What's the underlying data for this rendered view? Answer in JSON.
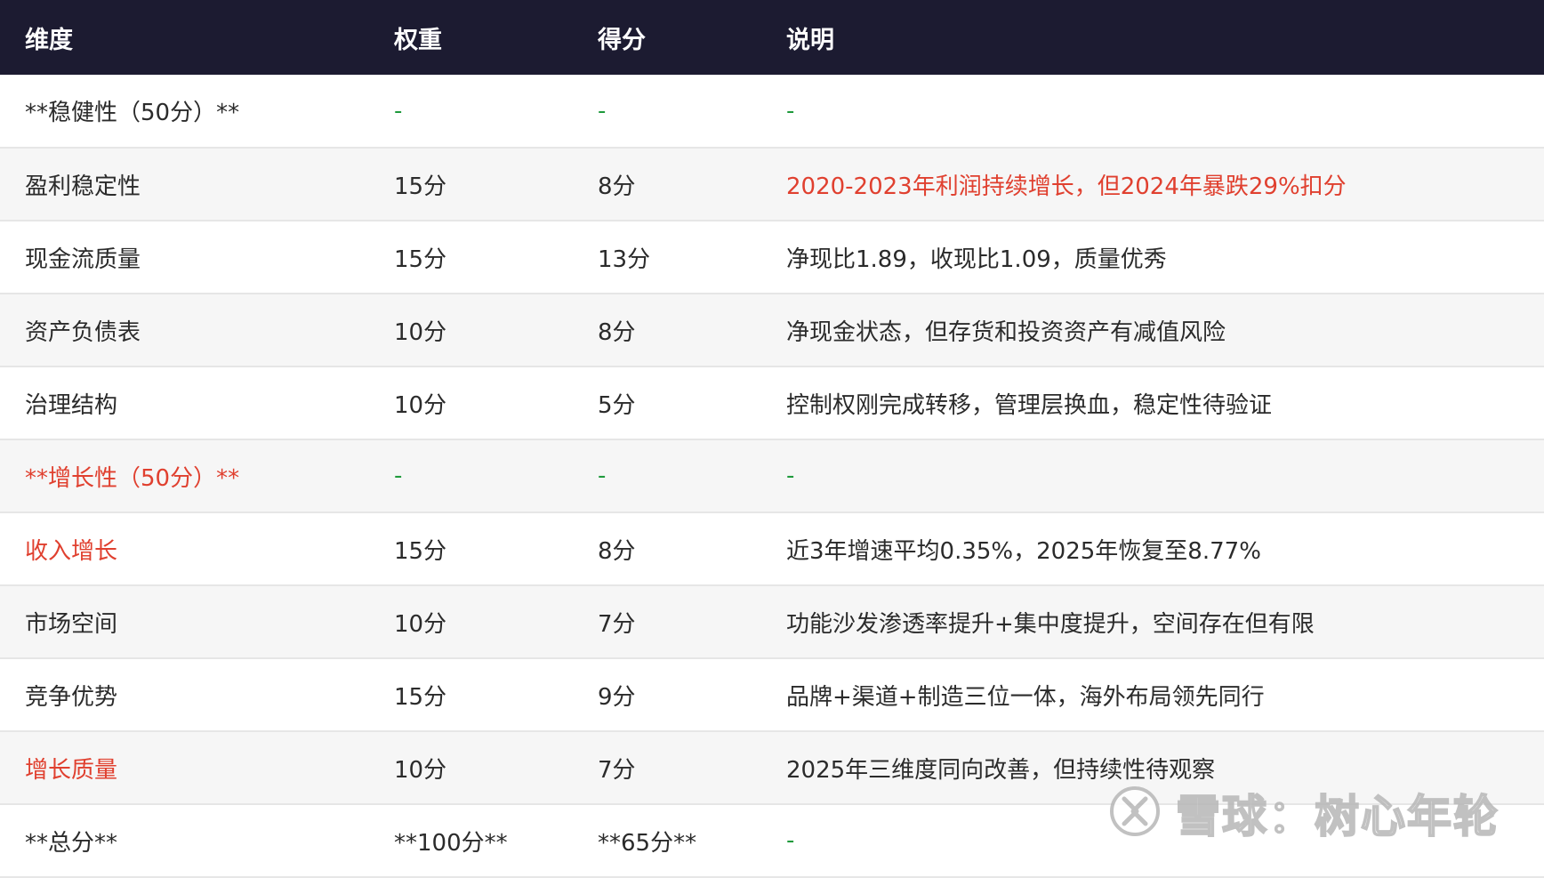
{
  "table": {
    "headers": [
      "维度",
      "权重",
      "得分",
      "说明"
    ],
    "rows": [
      {
        "dimension": "**稳健性（50分）**",
        "weight": "-",
        "score": "-",
        "note": "-"
      },
      {
        "dimension": "盈利稳定性",
        "weight": "15分",
        "score": "8分",
        "note": "2020-2023年利润持续增长，但2024年暴跌29%扣分"
      },
      {
        "dimension": "现金流质量",
        "weight": "15分",
        "score": "13分",
        "note": "净现比1.89，收现比1.09，质量优秀"
      },
      {
        "dimension": "资产负债表",
        "weight": "10分",
        "score": "8分",
        "note": "净现金状态，但存货和投资资产有减值风险"
      },
      {
        "dimension": "治理结构",
        "weight": "10分",
        "score": "5分",
        "note": "控制权刚完成转移，管理层换血，稳定性待验证"
      },
      {
        "dimension": "**增长性（50分）**",
        "weight": "-",
        "score": "-",
        "note": "-"
      },
      {
        "dimension": "收入增长",
        "weight": "15分",
        "score": "8分",
        "note": "近3年增速平均0.35%，2025年恢复至8.77%"
      },
      {
        "dimension": "市场空间",
        "weight": "10分",
        "score": "7分",
        "note": "功能沙发渗透率提升+集中度提升，空间存在但有限"
      },
      {
        "dimension": "竞争优势",
        "weight": "15分",
        "score": "9分",
        "note": "品牌+渠道+制造三位一体，海外布局领先同行"
      },
      {
        "dimension": "增长质量",
        "weight": "10分",
        "score": "7分",
        "note": "2025年三维度同向改善，但持续性待观察"
      },
      {
        "dimension": "**总分**",
        "weight": "**100分**",
        "score": "**65分**",
        "note": "-"
      }
    ]
  },
  "watermark": {
    "text": "雪球：树心年轮"
  },
  "colors": {
    "header_bg": "#1c1b31",
    "accent_red": "#e0402f",
    "dash_green": "#1f9a3c",
    "stripe_bg": "#f6f6f6"
  }
}
